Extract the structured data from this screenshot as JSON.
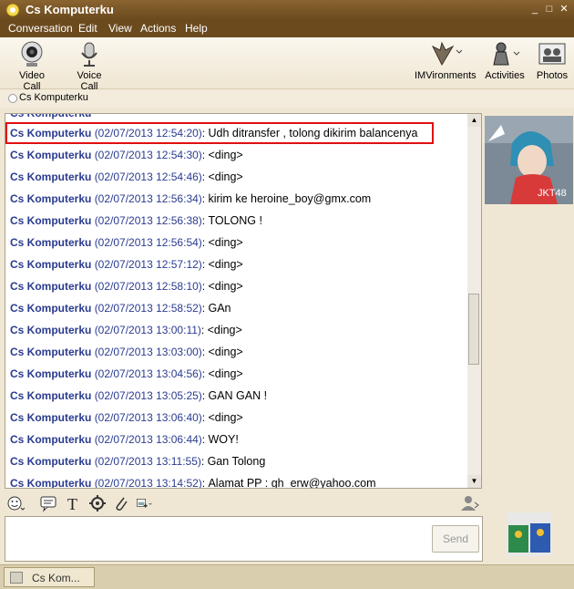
{
  "window": {
    "title": "Cs Komputerku",
    "controls": [
      "minimize-icon",
      "maximize-icon",
      "close-icon"
    ]
  },
  "menu": [
    "Conversation",
    "Edit",
    "View",
    "Actions",
    "Help"
  ],
  "toolbar": {
    "video_call": "Video Call",
    "voice_call": "Voice Call",
    "imvironments": "IMVironments",
    "activities": "Activities",
    "photos": "Photos"
  },
  "contact": {
    "name": "Cs Komputerku"
  },
  "messages": [
    {
      "sender": "Cs Komputerku",
      "time": "(02/07/2013 12:54:20)",
      "text": "Udh ditransfer , tolong dikirim balancenya",
      "highlighted": true
    },
    {
      "sender": "Cs Komputerku",
      "time": "(02/07/2013 12:54:30)",
      "text": "<ding>"
    },
    {
      "sender": "Cs Komputerku",
      "time": "(02/07/2013 12:54:46)",
      "text": "<ding>"
    },
    {
      "sender": "Cs Komputerku",
      "time": "(02/07/2013 12:56:34)",
      "text": "kirim ke heroine_boy@gmx.com"
    },
    {
      "sender": "Cs Komputerku",
      "time": "(02/07/2013 12:56:38)",
      "text": "TOLONG !"
    },
    {
      "sender": "Cs Komputerku",
      "time": "(02/07/2013 12:56:54)",
      "text": "<ding>"
    },
    {
      "sender": "Cs Komputerku",
      "time": "(02/07/2013 12:57:12)",
      "text": "<ding>"
    },
    {
      "sender": "Cs Komputerku",
      "time": "(02/07/2013 12:58:10)",
      "text": "<ding>"
    },
    {
      "sender": "Cs Komputerku",
      "time": "(02/07/2013 12:58:52)",
      "text": "GAn"
    },
    {
      "sender": "Cs Komputerku",
      "time": "(02/07/2013 13:00:11)",
      "text": "<ding>"
    },
    {
      "sender": "Cs Komputerku",
      "time": "(02/07/2013 13:03:00)",
      "text": "<ding>"
    },
    {
      "sender": "Cs Komputerku",
      "time": "(02/07/2013 13:04:56)",
      "text": "<ding>"
    },
    {
      "sender": "Cs Komputerku",
      "time": "(02/07/2013 13:05:25)",
      "text": "GAN GAN !"
    },
    {
      "sender": "Cs Komputerku",
      "time": "(02/07/2013 13:06:40)",
      "text": "<ding>"
    },
    {
      "sender": "Cs Komputerku",
      "time": "(02/07/2013 13:06:44)",
      "text": "WOY!"
    },
    {
      "sender": "Cs Komputerku",
      "time": "(02/07/2013 13:11:55)",
      "text": "Gan Tolong"
    },
    {
      "sender": "Cs Komputerku",
      "time": "(02/07/2013 13:14:52)",
      "text": "Alamat PP : gh_erw@yahoo.com"
    }
  ],
  "avatar_text": "JKT48",
  "send_button": "Send",
  "taskbar": {
    "item_label": "Cs Kom..."
  },
  "colors": {
    "title_bar": "#6b4a1e",
    "sender": "#2a3b8f",
    "highlight_border": "#e01010"
  }
}
